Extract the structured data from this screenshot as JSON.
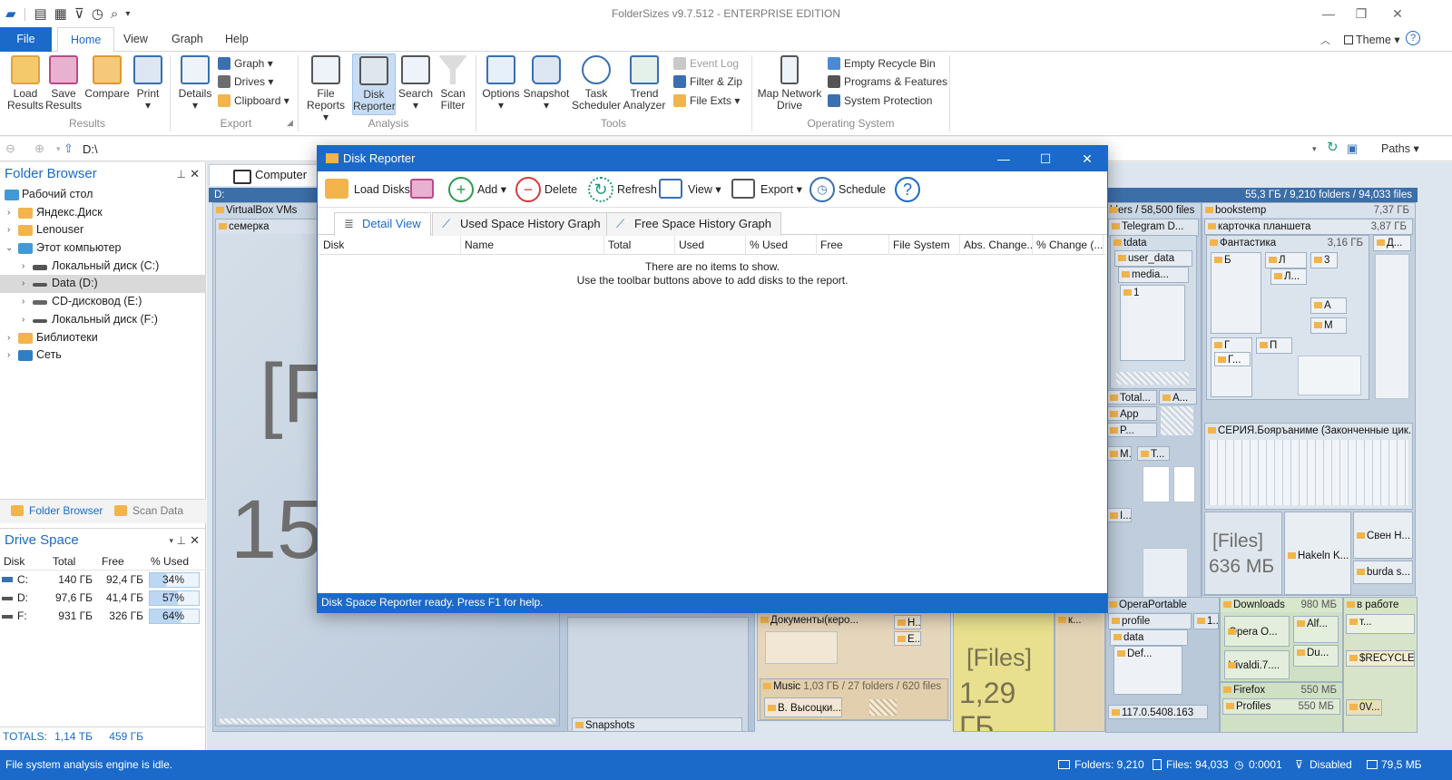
{
  "app": {
    "title": "FolderSizes v9.7.512 - ENTERPRISE EDITION"
  },
  "ribbon_tabs": [
    "File",
    "Home",
    "View",
    "Graph",
    "Help"
  ],
  "theme_label": "Theme",
  "ribbon": {
    "results": {
      "load": "Load Results",
      "save": "Save Results",
      "compare": "Compare",
      "print": "Print",
      "group": "Results"
    },
    "export": {
      "details": "Details",
      "graph": "Graph",
      "drives": "Drives",
      "clipboard": "Clipboard",
      "group": "Export"
    },
    "analysis": {
      "file_reports": "File Reports",
      "disk_reporter": "Disk Reporter",
      "search": "Search",
      "scan_filter": "Scan Filter",
      "group": "Analysis"
    },
    "tools": {
      "options": "Options",
      "snapshot": "Snapshot",
      "task_scheduler": "Task Scheduler",
      "trend_analyzer": "Trend Analyzer",
      "event_log": "Event Log",
      "filter_zip": "Filter & Zip",
      "file_exts": "File Exts",
      "group": "Tools"
    },
    "os": {
      "map_network_drive": "Map Network Drive",
      "empty_recycle_bin": "Empty Recycle Bin",
      "programs_features": "Programs & Features",
      "system_protection": "System Protection",
      "group": "Operating System"
    }
  },
  "address": {
    "path": "D:\\",
    "paths_label": "Paths"
  },
  "folder_browser": {
    "title": "Folder Browser",
    "nodes": [
      {
        "label": "Рабочий стол"
      },
      {
        "label": "Яндекс.Диск"
      },
      {
        "label": "Lenouser"
      },
      {
        "label": "Этот компьютер"
      },
      {
        "label": "Локальный диск (C:)"
      },
      {
        "label": "Data (D:)"
      },
      {
        "label": "CD-дисковод (E:)"
      },
      {
        "label": "Локальный диск (F:)"
      },
      {
        "label": "Библиотеки"
      },
      {
        "label": "Сеть"
      }
    ],
    "tab_folder_browser": "Folder Browser",
    "tab_scan_data": "Scan Data"
  },
  "drive_space": {
    "title": "Drive Space",
    "columns": [
      "Disk",
      "Total",
      "Free",
      "% Used"
    ],
    "rows": [
      {
        "disk": "C:",
        "total": "140 ГБ",
        "free": "92,4 ГБ",
        "used": "34%",
        "used_frac": 0.34
      },
      {
        "disk": "D:",
        "total": "97,6 ГБ",
        "free": "41,4 ГБ",
        "used": "57%",
        "used_frac": 0.57
      },
      {
        "disk": "F:",
        "total": "931 ГБ",
        "free": "326 ГБ",
        "used": "64%",
        "used_frac": 0.64
      }
    ],
    "totals_label": "TOTALS:",
    "totals_total": "1,14 ТБ",
    "totals_free": "459 ГБ"
  },
  "treemap": {
    "tab": "Computer",
    "root_label": "D:",
    "root_summary": "55,3 ГБ / 9,210 folders / 94,033 files",
    "big_text_1": "[F",
    "big_text_2": "15",
    "labels": {
      "virtualbox": "VirtualBox VMs",
      "semerka": "семерка",
      "snapshots": "Snapshots",
      "telegram_files": "lders / 58,500 files",
      "telegram": "Telegram D...",
      "tdata": "tdata",
      "user_data": "user_data",
      "media": "media...",
      "one": "1",
      "total": "Total...",
      "a_dots": "A...",
      "app": "App",
      "p_dots": "P...",
      "m_dot": "M.",
      "t_dots": "T...",
      "i_dots": "I...",
      "bookstemp": "bookstemp",
      "bookstemp_size": "7,37 ГБ",
      "kartochka": "карточка планшета",
      "kartochka_size": "3,87 ГБ",
      "fantastika": "Фантастика",
      "fantastika_size": "3,16 ГБ",
      "d_dots": "Д...",
      "b": "Б",
      "l": "Л",
      "l_dots": "Л...",
      "three": "3",
      "a": "А",
      "m": "М",
      "g": "Г",
      "g_dots": "Г...",
      "p": "П",
      "seriya": "СЕРИЯ.Бояръаниме (Законченные цик...",
      "files_636_a": "[Files]",
      "files_636_b": "636 МБ",
      "hakeln": "Hakeln K...",
      "sven": "Свен Н...",
      "burda": "burda s...",
      "opera_portable": "OperaPortable",
      "profile": "profile",
      "data": "data",
      "def": "Def...",
      "one_dots": "1...",
      "ver": "117.0.5408.163",
      "downloads": "Downloads",
      "downloads_size": "980 МБ",
      "opera_o": "Opera O...",
      "alf": "Alf...",
      "du": "Du...",
      "vivaldi": "Vivaldi.7....",
      "v_rabote": "в работе",
      "t_dots2": "т...",
      "recycle": "$RECYCLE....",
      "firefox": "Firefox",
      "firefox_size": "550 МБ",
      "profiles": "Profiles",
      "profiles_size": "550 МБ",
      "ov": "0V...",
      "dokumenty": "Документы(керо...",
      "n_dots": "Н...",
      "e_dots": "Е...",
      "k_dots": "к...",
      "music": "Music",
      "music_info": "1,03 ГБ / 27 folders / 620 files",
      "vysotski": "В. Высоцки...",
      "files_129_a": "[Files]",
      "files_129_b": "1,29 ГБ"
    }
  },
  "dialog": {
    "title": "Disk Reporter",
    "toolbar": {
      "load_disks": "Load Disks",
      "add": "Add",
      "delete": "Delete",
      "refresh": "Refresh",
      "view": "View",
      "export": "Export",
      "schedule": "Schedule"
    },
    "tabs": [
      "Detail View",
      "Used Space History Graph",
      "Free Space History Graph"
    ],
    "columns": [
      "Disk",
      "Name",
      "Total",
      "Used",
      "% Used",
      "Free",
      "File System",
      "Abs. Change...",
      "% Change (..."
    ],
    "empty_line1": "There are no items to show.",
    "empty_line2": "Use the toolbar buttons above to add disks to the report.",
    "status": "Disk Space Reporter ready. Press F1 for help."
  },
  "statusbar": {
    "message": "File system analysis engine is idle.",
    "folders": "Folders: 9,210",
    "files": "Files: 94,033",
    "time": "0:0001",
    "filter": "Disabled",
    "memory": "79,5 МБ"
  },
  "colors": {
    "accent": "#1b6ac9",
    "folder": "#f2b44b"
  }
}
